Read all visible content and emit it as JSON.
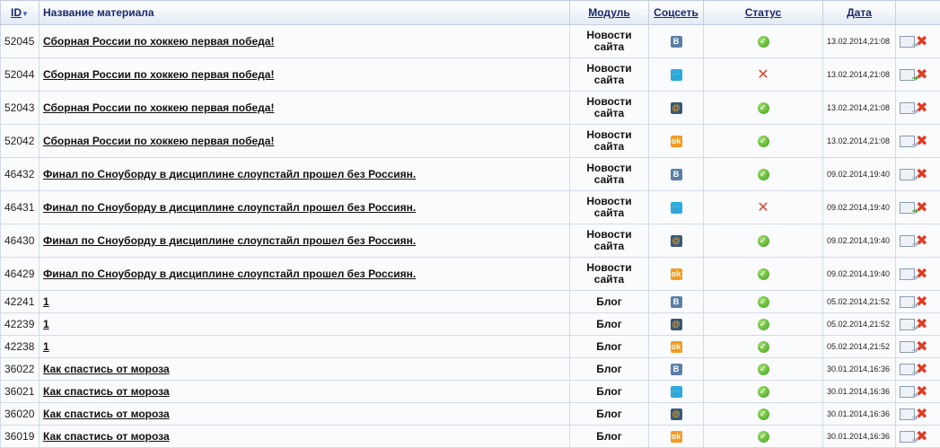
{
  "header": {
    "id": "ID",
    "name": "Название материала",
    "module": "Модуль",
    "social": "Соцсеть",
    "status": "Статус",
    "date": "Дата",
    "sort_icon": "sort-desc-arrow"
  },
  "social_glyphs": {
    "vk": "B",
    "tw": "🐦",
    "mr": "@",
    "ok": "ok"
  },
  "colors": {
    "header_text": "#1a2a6c",
    "success": "#3f9e1a",
    "error": "#e2452b",
    "delete": "#e23a22"
  },
  "rows": [
    {
      "id": "52045",
      "name": "Сборная России по хоккею первая победа!",
      "module": "Новости сайта",
      "social": "vk",
      "status": "ok",
      "date": "13.02.2014,21:08",
      "send_active": false
    },
    {
      "id": "52044",
      "name": "Сборная России по хоккею первая победа!",
      "module": "Новости сайта",
      "social": "tw",
      "status": "error",
      "date": "13.02.2014,21:08",
      "send_active": true
    },
    {
      "id": "52043",
      "name": "Сборная России по хоккею первая победа!",
      "module": "Новости сайта",
      "social": "mr",
      "status": "ok",
      "date": "13.02.2014,21:08",
      "send_active": false
    },
    {
      "id": "52042",
      "name": "Сборная России по хоккею первая победа!",
      "module": "Новости сайта",
      "social": "ok",
      "status": "ok",
      "date": "13.02.2014,21:08",
      "send_active": false
    },
    {
      "id": "46432",
      "name": "Финал по Сноуборду в дисциплине слоупстайл прошел без Россиян.",
      "module": "Новости сайта",
      "social": "vk",
      "status": "ok",
      "date": "09.02.2014,19:40",
      "send_active": false
    },
    {
      "id": "46431",
      "name": "Финал по Сноуборду в дисциплине слоупстайл прошел без Россиян.",
      "module": "Новости сайта",
      "social": "tw",
      "status": "error",
      "date": "09.02.2014,19:40",
      "send_active": true
    },
    {
      "id": "46430",
      "name": "Финал по Сноуборду в дисциплине слоупстайл прошел без Россиян.",
      "module": "Новости сайта",
      "social": "mr",
      "status": "ok",
      "date": "09.02.2014,19:40",
      "send_active": false
    },
    {
      "id": "46429",
      "name": "Финал по Сноуборду в дисциплине слоупстайл прошел без Россиян.",
      "module": "Новости сайта",
      "social": "ok",
      "status": "ok",
      "date": "09.02.2014,19:40",
      "send_active": false
    },
    {
      "id": "42241",
      "name": "1",
      "module": "Блог",
      "social": "vk",
      "status": "ok",
      "date": "05.02.2014,21:52",
      "send_active": false
    },
    {
      "id": "42239",
      "name": "1",
      "module": "Блог",
      "social": "mr",
      "status": "ok",
      "date": "05.02.2014,21:52",
      "send_active": false
    },
    {
      "id": "42238",
      "name": "1",
      "module": "Блог",
      "social": "ok",
      "status": "ok",
      "date": "05.02.2014,21:52",
      "send_active": false
    },
    {
      "id": "36022",
      "name": "Как спастись от мороза",
      "module": "Блог",
      "social": "vk",
      "status": "ok",
      "date": "30.01.2014,16:36",
      "send_active": false
    },
    {
      "id": "36021",
      "name": "Как спастись от мороза",
      "module": "Блог",
      "social": "tw",
      "status": "ok",
      "date": "30.01.2014,16:36",
      "send_active": false
    },
    {
      "id": "36020",
      "name": "Как спастись от мороза",
      "module": "Блог",
      "social": "mr",
      "status": "ok",
      "date": "30.01.2014,16:36",
      "send_active": false
    },
    {
      "id": "36019",
      "name": "Как спастись от мороза",
      "module": "Блог",
      "social": "ok",
      "status": "ok",
      "date": "30.01.2014,16:36",
      "send_active": false
    }
  ]
}
